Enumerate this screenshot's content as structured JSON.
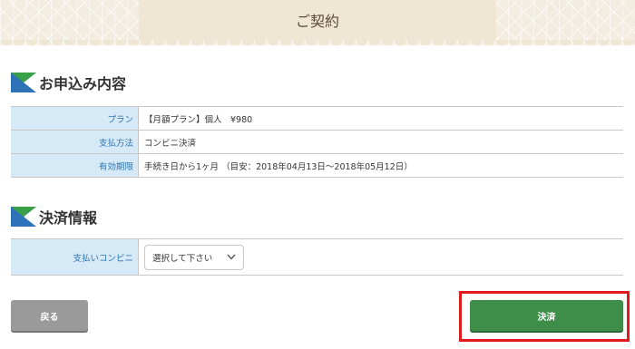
{
  "header": {
    "title": "ご契約"
  },
  "application": {
    "heading": "お申込み内容",
    "rows": [
      {
        "label": "プラン",
        "value": "【月額プラン】個人　¥980"
      },
      {
        "label": "支払方法",
        "value": "コンビニ決済"
      },
      {
        "label": "有効期限",
        "value": "手続き日から1ヶ月 （目安：2018年04月13日〜2018年05月12日）"
      }
    ]
  },
  "payment": {
    "heading": "決済情報",
    "convenience_label": "支払いコンビニ",
    "select_value": "選択して下さい"
  },
  "buttons": {
    "back": "戻る",
    "pay": "決済"
  },
  "colors": {
    "header_band": "#f3ece0",
    "label_bg": "#d6e9f6",
    "label_text": "#2d76b5",
    "back_button": "#9a9a9a",
    "pay_button": "#3e8e4a",
    "highlight": "#e01b1b"
  },
  "icons": {
    "section": "section-flag-icon",
    "dropdown": "chevron-down-icon"
  }
}
